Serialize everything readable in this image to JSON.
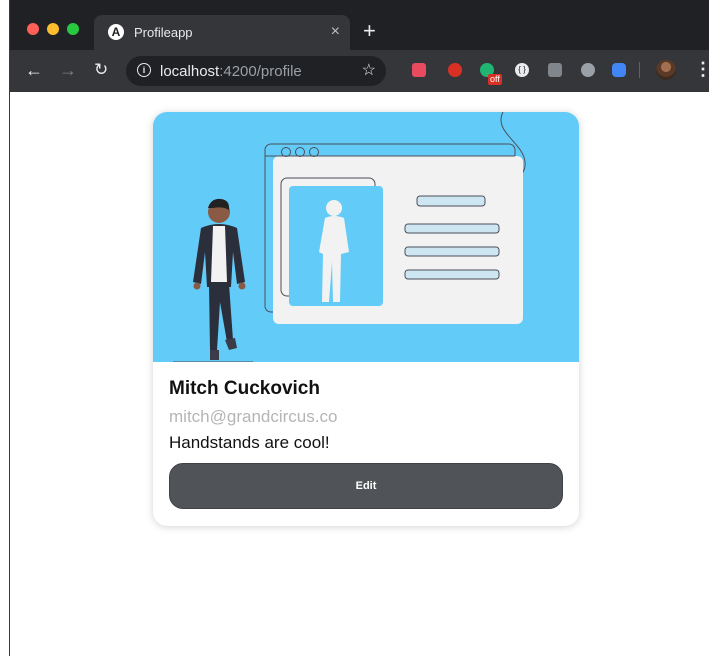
{
  "browser": {
    "tab_title": "Profileapp",
    "tab_favicon": "A",
    "tab_close": "×",
    "new_tab": "+",
    "url_host": "localhost",
    "url_rest": ":4200/profile",
    "ext_badge": "off"
  },
  "profile": {
    "name": "Mitch Cuckovich",
    "email": "mitch@grandcircus.co",
    "bio": "Handstands are cool!",
    "edit_label": "Edit"
  },
  "colors": {
    "hero_background": "#63cbf8",
    "button_background": "#505458"
  }
}
